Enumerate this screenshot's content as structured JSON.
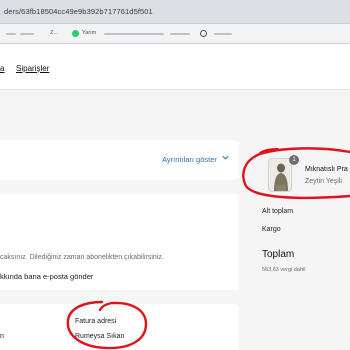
{
  "browser": {
    "url": "ders/63fb18504cc49e9b392b717761d5f501",
    "bookmarks": {
      "item1": "Z...",
      "item2": "Yarım"
    }
  },
  "nav": {
    "home_partial": "a",
    "orders_label": "Siparişler"
  },
  "order": {
    "show_details_label": "Ayrıntıları göster"
  },
  "newsletter": {
    "info_text": "caksınız. Dilediğiniz zaman abonelikten çıkabilirsiniz.",
    "checkbox_label": "kkında bana e-posta gönder"
  },
  "addresses": {
    "left_partial": "n",
    "billing_title": "Fatura adresi",
    "billing_name": "Rumeysa Sıkan"
  },
  "summary": {
    "product_name": "Mıknatıslı Pra",
    "product_variant": "Zeytin Yeşili",
    "quantity": "1",
    "subtotal_label": "Alt toplam",
    "shipping_label": "Kargo",
    "total_label": "Toplam",
    "tax_note": "563,63 vergi dahil"
  },
  "colors": {
    "annotation": "#e0121b",
    "link": "#2b6fb4"
  }
}
